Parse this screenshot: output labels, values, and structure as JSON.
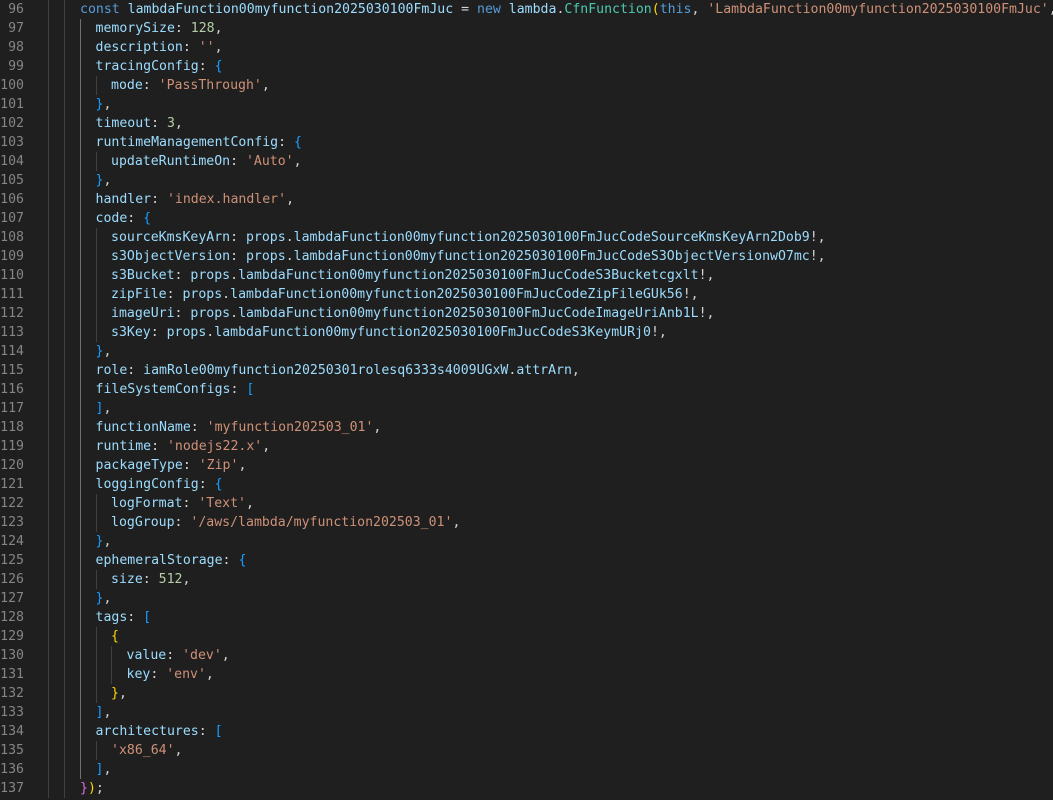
{
  "editor": {
    "language": "typescript",
    "lines": [
      {
        "number": "96",
        "indent": 0,
        "tokens": [
          [
            "const",
            "kw"
          ],
          [
            " ",
            "op"
          ],
          [
            "lambdaFunction00myfunction2025030100FmJuc",
            "var"
          ],
          [
            " = ",
            "op"
          ],
          [
            "new",
            "kw"
          ],
          [
            " ",
            "op"
          ],
          [
            "lambda",
            "var"
          ],
          [
            ".",
            "op"
          ],
          [
            "CfnFunction",
            "cls"
          ],
          [
            "(",
            "b1"
          ],
          [
            "this",
            "kw"
          ],
          [
            ", ",
            "op"
          ],
          [
            "'LambdaFunction00myfunction2025030100FmJuc'",
            "str"
          ],
          [
            ", ",
            "op"
          ],
          [
            "{",
            "b2"
          ]
        ]
      },
      {
        "number": "97",
        "indent": 1,
        "tokens": [
          [
            "memorySize",
            "var"
          ],
          [
            ": ",
            "op"
          ],
          [
            "128",
            "num"
          ],
          [
            ",",
            "op"
          ]
        ]
      },
      {
        "number": "98",
        "indent": 1,
        "tokens": [
          [
            "description",
            "var"
          ],
          [
            ": ",
            "op"
          ],
          [
            "''",
            "str"
          ],
          [
            ",",
            "op"
          ]
        ]
      },
      {
        "number": "99",
        "indent": 1,
        "tokens": [
          [
            "tracingConfig",
            "var"
          ],
          [
            ": ",
            "op"
          ],
          [
            "{",
            "b3"
          ]
        ]
      },
      {
        "number": "100",
        "indent": 2,
        "tokens": [
          [
            "mode",
            "var"
          ],
          [
            ": ",
            "op"
          ],
          [
            "'PassThrough'",
            "str"
          ],
          [
            ",",
            "op"
          ]
        ]
      },
      {
        "number": "101",
        "indent": 1,
        "tokens": [
          [
            "}",
            "b3"
          ],
          [
            ",",
            "op"
          ]
        ]
      },
      {
        "number": "102",
        "indent": 1,
        "tokens": [
          [
            "timeout",
            "var"
          ],
          [
            ": ",
            "op"
          ],
          [
            "3",
            "num"
          ],
          [
            ",",
            "op"
          ]
        ]
      },
      {
        "number": "103",
        "indent": 1,
        "tokens": [
          [
            "runtimeManagementConfig",
            "var"
          ],
          [
            ": ",
            "op"
          ],
          [
            "{",
            "b3"
          ]
        ]
      },
      {
        "number": "104",
        "indent": 2,
        "tokens": [
          [
            "updateRuntimeOn",
            "var"
          ],
          [
            ": ",
            "op"
          ],
          [
            "'Auto'",
            "str"
          ],
          [
            ",",
            "op"
          ]
        ]
      },
      {
        "number": "105",
        "indent": 1,
        "tokens": [
          [
            "}",
            "b3"
          ],
          [
            ",",
            "op"
          ]
        ]
      },
      {
        "number": "106",
        "indent": 1,
        "tokens": [
          [
            "handler",
            "var"
          ],
          [
            ": ",
            "op"
          ],
          [
            "'index.handler'",
            "str"
          ],
          [
            ",",
            "op"
          ]
        ]
      },
      {
        "number": "107",
        "indent": 1,
        "tokens": [
          [
            "code",
            "var"
          ],
          [
            ": ",
            "op"
          ],
          [
            "{",
            "b3"
          ]
        ]
      },
      {
        "number": "108",
        "indent": 2,
        "tokens": [
          [
            "sourceKmsKeyArn",
            "var"
          ],
          [
            ": ",
            "op"
          ],
          [
            "props",
            "var"
          ],
          [
            ".",
            "op"
          ],
          [
            "lambdaFunction00myfunction2025030100FmJucCodeSourceKmsKeyArn2Dob9",
            "var"
          ],
          [
            "!,",
            "op"
          ]
        ]
      },
      {
        "number": "109",
        "indent": 2,
        "tokens": [
          [
            "s3ObjectVersion",
            "var"
          ],
          [
            ": ",
            "op"
          ],
          [
            "props",
            "var"
          ],
          [
            ".",
            "op"
          ],
          [
            "lambdaFunction00myfunction2025030100FmJucCodeS3ObjectVersionwO7mc",
            "var"
          ],
          [
            "!,",
            "op"
          ]
        ]
      },
      {
        "number": "110",
        "indent": 2,
        "tokens": [
          [
            "s3Bucket",
            "var"
          ],
          [
            ": ",
            "op"
          ],
          [
            "props",
            "var"
          ],
          [
            ".",
            "op"
          ],
          [
            "lambdaFunction00myfunction2025030100FmJucCodeS3Bucketcgxlt",
            "var"
          ],
          [
            "!,",
            "op"
          ]
        ]
      },
      {
        "number": "111",
        "indent": 2,
        "tokens": [
          [
            "zipFile",
            "var"
          ],
          [
            ": ",
            "op"
          ],
          [
            "props",
            "var"
          ],
          [
            ".",
            "op"
          ],
          [
            "lambdaFunction00myfunction2025030100FmJucCodeZipFileGUk56",
            "var"
          ],
          [
            "!,",
            "op"
          ]
        ]
      },
      {
        "number": "112",
        "indent": 2,
        "tokens": [
          [
            "imageUri",
            "var"
          ],
          [
            ": ",
            "op"
          ],
          [
            "props",
            "var"
          ],
          [
            ".",
            "op"
          ],
          [
            "lambdaFunction00myfunction2025030100FmJucCodeImageUriAnb1L",
            "var"
          ],
          [
            "!,",
            "op"
          ]
        ]
      },
      {
        "number": "113",
        "indent": 2,
        "tokens": [
          [
            "s3Key",
            "var"
          ],
          [
            ": ",
            "op"
          ],
          [
            "props",
            "var"
          ],
          [
            ".",
            "op"
          ],
          [
            "lambdaFunction00myfunction2025030100FmJucCodeS3KeymURj0",
            "var"
          ],
          [
            "!,",
            "op"
          ]
        ]
      },
      {
        "number": "114",
        "indent": 1,
        "tokens": [
          [
            "}",
            "b3"
          ],
          [
            ",",
            "op"
          ]
        ]
      },
      {
        "number": "115",
        "indent": 1,
        "tokens": [
          [
            "role",
            "var"
          ],
          [
            ": ",
            "op"
          ],
          [
            "iamRole00myfunction20250301rolesq6333s4009UGxW",
            "var"
          ],
          [
            ".",
            "op"
          ],
          [
            "attrArn",
            "var"
          ],
          [
            ",",
            "op"
          ]
        ]
      },
      {
        "number": "116",
        "indent": 1,
        "tokens": [
          [
            "fileSystemConfigs",
            "var"
          ],
          [
            ": ",
            "op"
          ],
          [
            "[",
            "b3"
          ]
        ]
      },
      {
        "number": "117",
        "indent": 1,
        "tokens": [
          [
            "]",
            "b3"
          ],
          [
            ",",
            "op"
          ]
        ]
      },
      {
        "number": "118",
        "indent": 1,
        "tokens": [
          [
            "functionName",
            "var"
          ],
          [
            ": ",
            "op"
          ],
          [
            "'myfunction202503_01'",
            "str"
          ],
          [
            ",",
            "op"
          ]
        ]
      },
      {
        "number": "119",
        "indent": 1,
        "tokens": [
          [
            "runtime",
            "var"
          ],
          [
            ": ",
            "op"
          ],
          [
            "'nodejs22.x'",
            "str"
          ],
          [
            ",",
            "op"
          ]
        ]
      },
      {
        "number": "120",
        "indent": 1,
        "tokens": [
          [
            "packageType",
            "var"
          ],
          [
            ": ",
            "op"
          ],
          [
            "'Zip'",
            "str"
          ],
          [
            ",",
            "op"
          ]
        ]
      },
      {
        "number": "121",
        "indent": 1,
        "tokens": [
          [
            "loggingConfig",
            "var"
          ],
          [
            ": ",
            "op"
          ],
          [
            "{",
            "b3"
          ]
        ]
      },
      {
        "number": "122",
        "indent": 2,
        "tokens": [
          [
            "logFormat",
            "var"
          ],
          [
            ": ",
            "op"
          ],
          [
            "'Text'",
            "str"
          ],
          [
            ",",
            "op"
          ]
        ]
      },
      {
        "number": "123",
        "indent": 2,
        "tokens": [
          [
            "logGroup",
            "var"
          ],
          [
            ": ",
            "op"
          ],
          [
            "'/aws/lambda/myfunction202503_01'",
            "str"
          ],
          [
            ",",
            "op"
          ]
        ]
      },
      {
        "number": "124",
        "indent": 1,
        "tokens": [
          [
            "}",
            "b3"
          ],
          [
            ",",
            "op"
          ]
        ]
      },
      {
        "number": "125",
        "indent": 1,
        "tokens": [
          [
            "ephemeralStorage",
            "var"
          ],
          [
            ": ",
            "op"
          ],
          [
            "{",
            "b3"
          ]
        ]
      },
      {
        "number": "126",
        "indent": 2,
        "tokens": [
          [
            "size",
            "var"
          ],
          [
            ": ",
            "op"
          ],
          [
            "512",
            "num"
          ],
          [
            ",",
            "op"
          ]
        ]
      },
      {
        "number": "127",
        "indent": 1,
        "tokens": [
          [
            "}",
            "b3"
          ],
          [
            ",",
            "op"
          ]
        ]
      },
      {
        "number": "128",
        "indent": 1,
        "tokens": [
          [
            "tags",
            "var"
          ],
          [
            ": ",
            "op"
          ],
          [
            "[",
            "b3"
          ]
        ]
      },
      {
        "number": "129",
        "indent": 2,
        "tokens": [
          [
            "{",
            "b1"
          ]
        ]
      },
      {
        "number": "130",
        "indent": 3,
        "tokens": [
          [
            "value",
            "var"
          ],
          [
            ": ",
            "op"
          ],
          [
            "'dev'",
            "str"
          ],
          [
            ",",
            "op"
          ]
        ]
      },
      {
        "number": "131",
        "indent": 3,
        "tokens": [
          [
            "key",
            "var"
          ],
          [
            ": ",
            "op"
          ],
          [
            "'env'",
            "str"
          ],
          [
            ",",
            "op"
          ]
        ]
      },
      {
        "number": "132",
        "indent": 2,
        "tokens": [
          [
            "}",
            "b1"
          ],
          [
            ",",
            "op"
          ]
        ]
      },
      {
        "number": "133",
        "indent": 1,
        "tokens": [
          [
            "]",
            "b3"
          ],
          [
            ",",
            "op"
          ]
        ]
      },
      {
        "number": "134",
        "indent": 1,
        "tokens": [
          [
            "architectures",
            "var"
          ],
          [
            ": ",
            "op"
          ],
          [
            "[",
            "b3"
          ]
        ]
      },
      {
        "number": "135",
        "indent": 2,
        "tokens": [
          [
            "'x86_64'",
            "str"
          ],
          [
            ",",
            "op"
          ]
        ]
      },
      {
        "number": "136",
        "indent": 1,
        "tokens": [
          [
            "]",
            "b3"
          ],
          [
            ",",
            "op"
          ]
        ]
      },
      {
        "number": "137",
        "indent": 0,
        "tokens": [
          [
            "}",
            "b2"
          ],
          [
            ")",
            "b1"
          ],
          [
            ";",
            "op"
          ]
        ]
      }
    ]
  },
  "colors": {
    "background": "#1f1f1f",
    "line_number": "#858585",
    "indent_guide": "#404040",
    "active_indent_guide": "#707070",
    "keyword": "#569cd6",
    "variable": "#9cdcfe",
    "class": "#4ec9b0",
    "string": "#ce9178",
    "number": "#b5cea8",
    "punctuation": "#d4d4d4",
    "bracket_level_1": "#ffd700",
    "bracket_level_2": "#da70d6",
    "bracket_level_3": "#179fff"
  }
}
